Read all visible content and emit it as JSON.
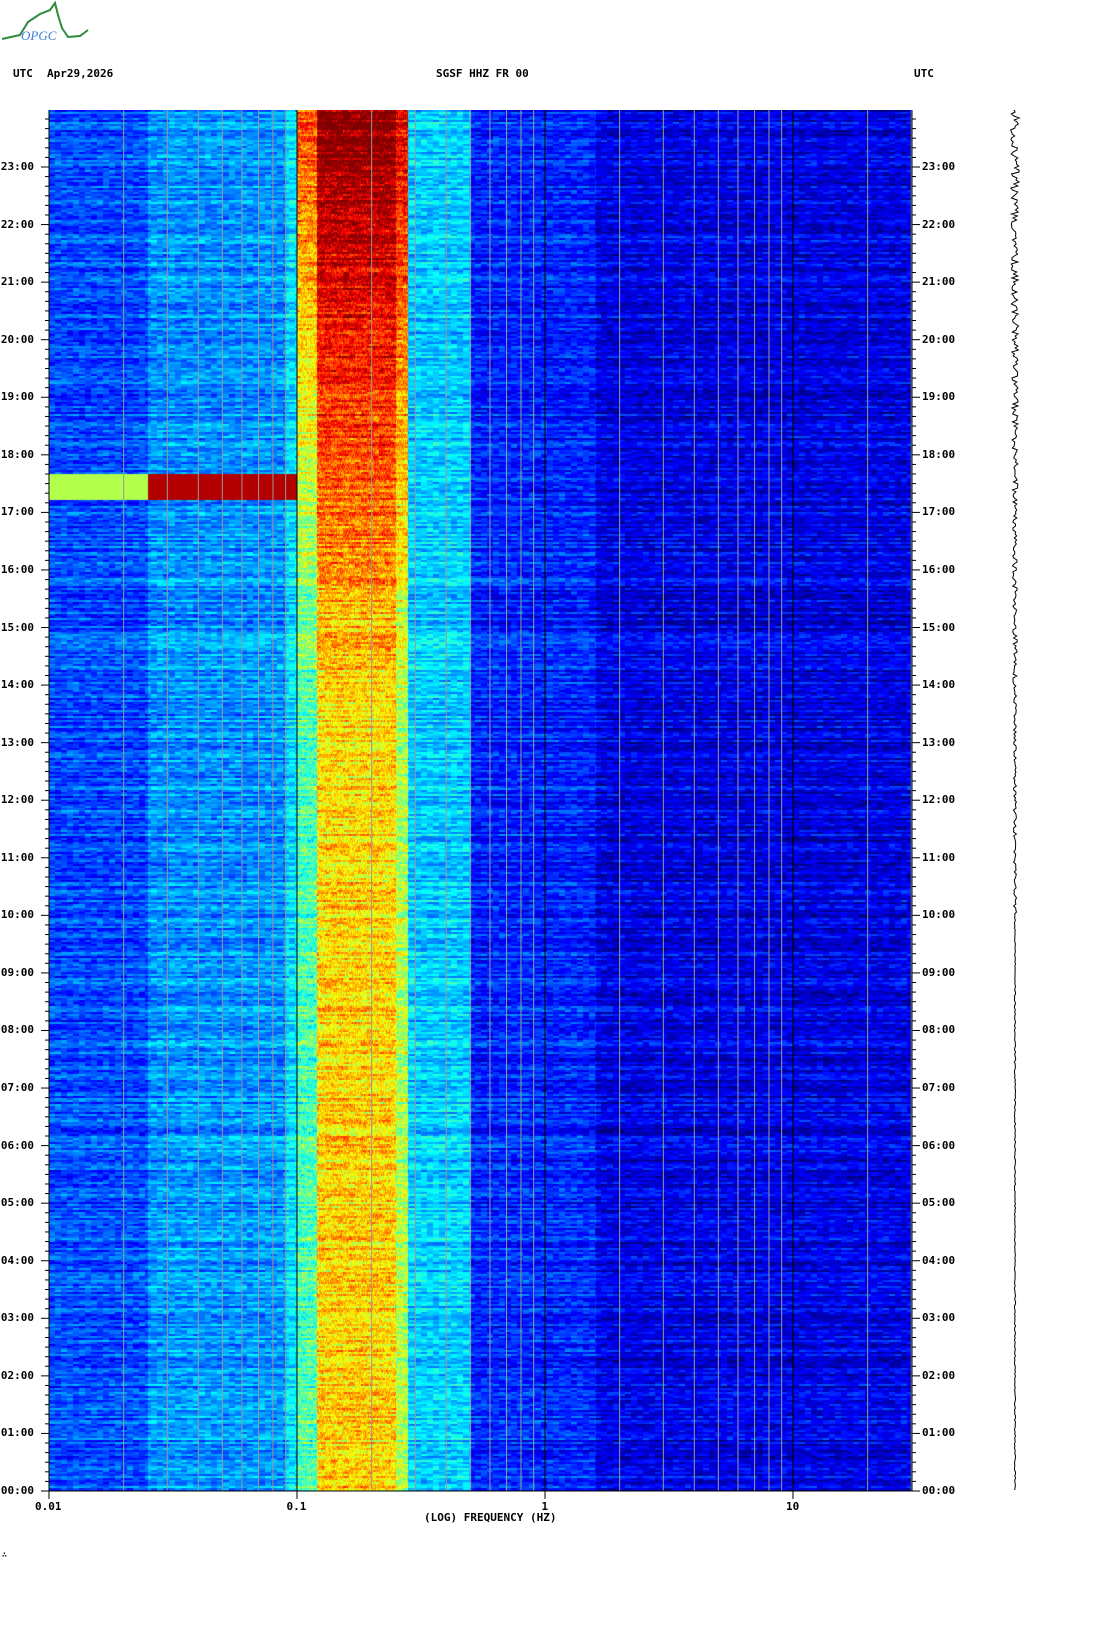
{
  "header": {
    "left_tz": "UTC",
    "date": "Apr29,2026",
    "station": "SGSF HHZ FR 00",
    "right_tz": "UTC",
    "logo_text": "OPGC"
  },
  "footer_mark": "∴",
  "chart_data": {
    "type": "heatmap",
    "title": "SGSF HHZ FR 00",
    "xlabel": "(LOG) FREQUENCY (HZ)",
    "ylabel": "UTC",
    "x_scale": "log",
    "xlim": [
      0.01,
      30
    ],
    "x_ticks": [
      {
        "value": 0.01,
        "label": "0.01"
      },
      {
        "value": 0.1,
        "label": "0.1"
      },
      {
        "value": 1,
        "label": "1"
      },
      {
        "value": 10,
        "label": "10"
      }
    ],
    "ylim_hours": [
      0,
      24
    ],
    "y_ticks": [
      "00:00",
      "01:00",
      "02:00",
      "03:00",
      "04:00",
      "05:00",
      "06:00",
      "07:00",
      "08:00",
      "09:00",
      "10:00",
      "11:00",
      "12:00",
      "13:00",
      "14:00",
      "15:00",
      "16:00",
      "17:00",
      "18:00",
      "19:00",
      "20:00",
      "21:00",
      "22:00",
      "23:00"
    ],
    "colormap": "jet",
    "grid": true,
    "frequency_bands": [
      {
        "f_min": 0.01,
        "f_max": 0.025,
        "intensity": 0.2
      },
      {
        "f_min": 0.025,
        "f_max": 0.09,
        "intensity": 0.27
      },
      {
        "f_min": 0.09,
        "f_max": 0.1,
        "intensity": 0.35
      },
      {
        "f_min": 0.1,
        "f_max": 0.12,
        "intensity": 0.45
      },
      {
        "f_min": 0.12,
        "f_max": 0.25,
        "intensity": 0.66
      },
      {
        "f_min": 0.25,
        "f_max": 0.28,
        "intensity": 0.55
      },
      {
        "f_min": 0.28,
        "f_max": 0.5,
        "intensity": 0.33
      },
      {
        "f_min": 0.5,
        "f_max": 1.6,
        "intensity": 0.16
      },
      {
        "f_min": 1.6,
        "f_max": 30,
        "intensity": 0.1
      }
    ],
    "microseism_increase": {
      "start_hour": 14,
      "end_hour": 24,
      "extra_intensity": 0.35
    },
    "events": [
      {
        "start_hour": 17.25,
        "end_hour": 17.7,
        "f_min": 0.01,
        "f_max": 0.1,
        "intensity": 0.95
      }
    ]
  }
}
